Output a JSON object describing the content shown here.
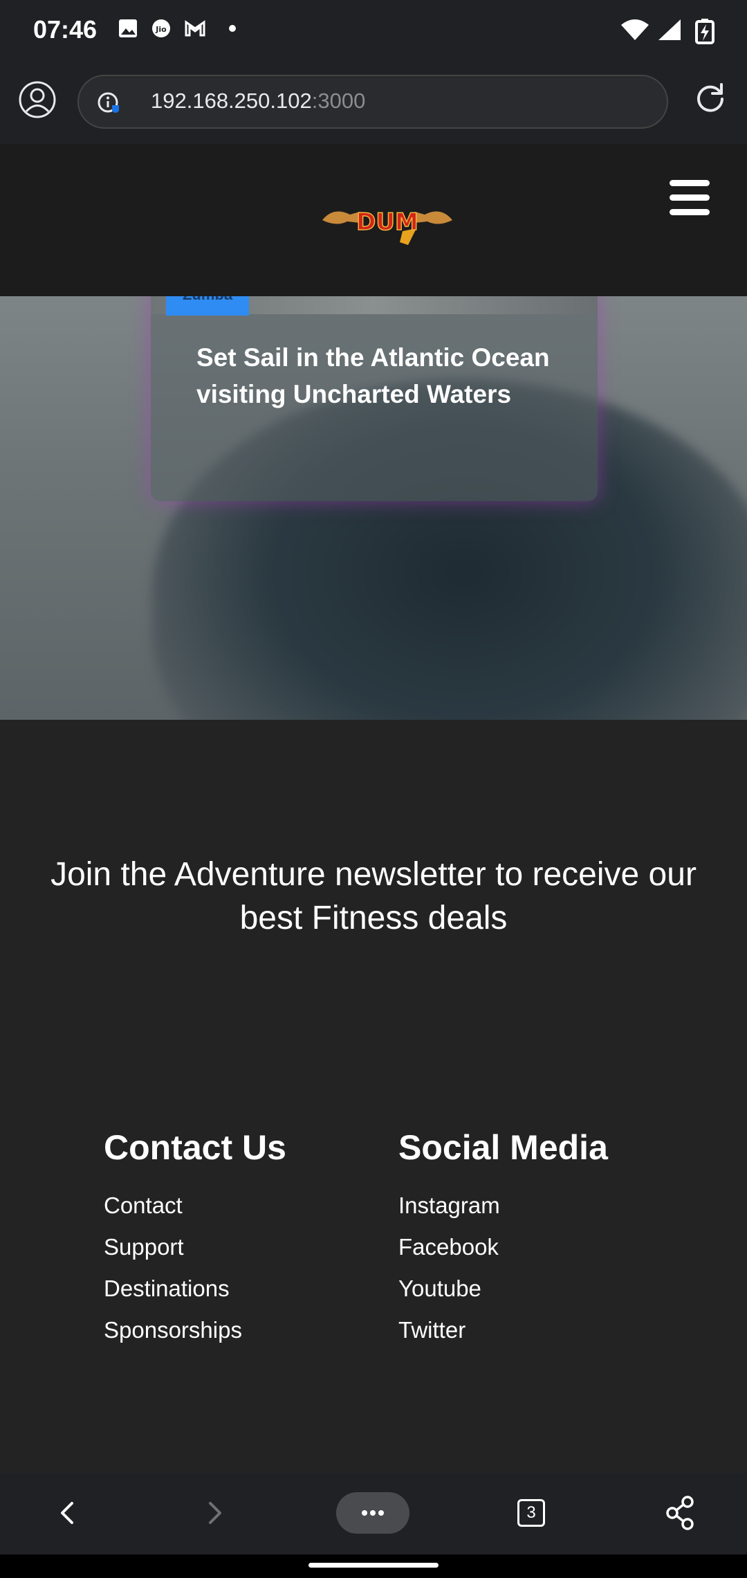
{
  "status_bar": {
    "time": "07:46",
    "left_icons": [
      "gallery-icon",
      "jio-icon",
      "gmail-icon",
      "dot-icon"
    ],
    "right_icons": [
      "wifi-icon",
      "signal-icon",
      "battery-charging-icon"
    ]
  },
  "browser": {
    "url_host": "192.168.250.102",
    "url_port": ":3000",
    "tab_count": "3"
  },
  "site": {
    "logo_text": "DUM"
  },
  "hero": {
    "card_tag": "Zumba",
    "card_title": "Set Sail in the Atlantic Ocean visiting Uncharted Waters"
  },
  "newsletter": {
    "text": "Join the Adventure newsletter to receive our best Fitness deals"
  },
  "footer": {
    "contact": {
      "heading": "Contact Us",
      "links": [
        "Contact",
        "Support",
        "Destinations",
        "Sponsorships"
      ]
    },
    "social": {
      "heading": "Social Media",
      "links": [
        "Instagram",
        "Facebook",
        "Youtube",
        "Twitter"
      ]
    }
  },
  "colors": {
    "page_bg": "#232323",
    "header_bg": "#1c1c1c",
    "browser_bg": "#202124",
    "tag_blue": "#2f8cf2",
    "card_glow": "#aa3cbe"
  }
}
